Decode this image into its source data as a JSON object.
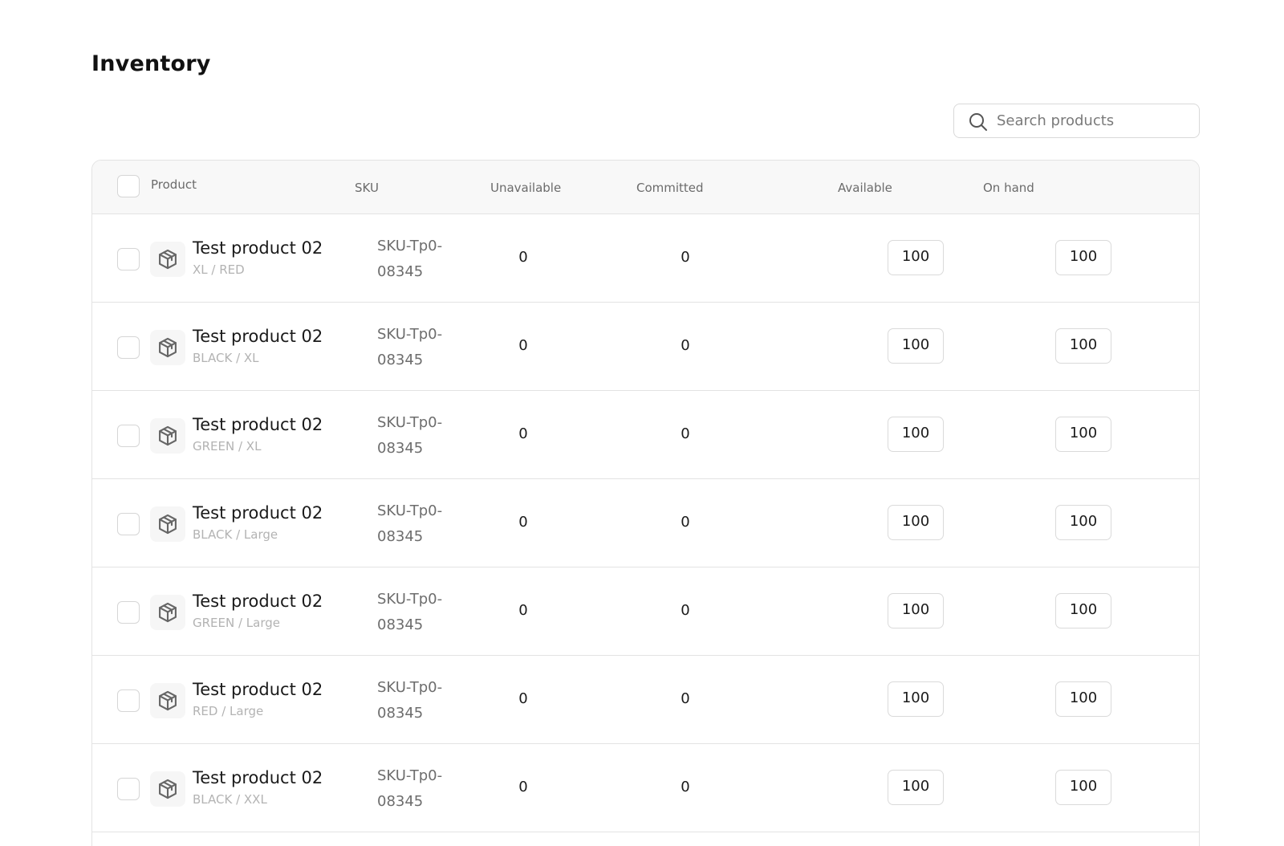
{
  "page": {
    "title": "Inventory"
  },
  "search": {
    "placeholder": "Search products",
    "value": ""
  },
  "table": {
    "headers": {
      "product": "Product",
      "sku": "SKU",
      "unavailable": "Unavailable",
      "committed": "Committed",
      "available": "Available",
      "on_hand": "On hand"
    },
    "rows": [
      {
        "name": "Test product 02",
        "variant": "XL / RED",
        "sku_line1": "SKU-Tp0-",
        "sku_line2": "08345",
        "unavailable": "0",
        "committed": "0",
        "available": "100",
        "on_hand": "100"
      },
      {
        "name": "Test product 02",
        "variant": "BLACK / XL",
        "sku_line1": "SKU-Tp0-",
        "sku_line2": "08345",
        "unavailable": "0",
        "committed": "0",
        "available": "100",
        "on_hand": "100"
      },
      {
        "name": "Test product 02",
        "variant": "GREEN / XL",
        "sku_line1": "SKU-Tp0-",
        "sku_line2": "08345",
        "unavailable": "0",
        "committed": "0",
        "available": "100",
        "on_hand": "100"
      },
      {
        "name": "Test product 02",
        "variant": "BLACK / Large",
        "sku_line1": "SKU-Tp0-",
        "sku_line2": "08345",
        "unavailable": "0",
        "committed": "0",
        "available": "100",
        "on_hand": "100"
      },
      {
        "name": "Test product 02",
        "variant": "GREEN / Large",
        "sku_line1": "SKU-Tp0-",
        "sku_line2": "08345",
        "unavailable": "0",
        "committed": "0",
        "available": "100",
        "on_hand": "100"
      },
      {
        "name": "Test product 02",
        "variant": "RED / Large",
        "sku_line1": "SKU-Tp0-",
        "sku_line2": "08345",
        "unavailable": "0",
        "committed": "0",
        "available": "100",
        "on_hand": "100"
      },
      {
        "name": "Test product 02",
        "variant": "BLACK / XXL",
        "sku_line1": "SKU-Tp0-",
        "sku_line2": "08345",
        "unavailable": "0",
        "committed": "0",
        "available": "100",
        "on_hand": "100"
      }
    ]
  },
  "icons": {
    "search": "search-icon",
    "product": "package-icon"
  }
}
